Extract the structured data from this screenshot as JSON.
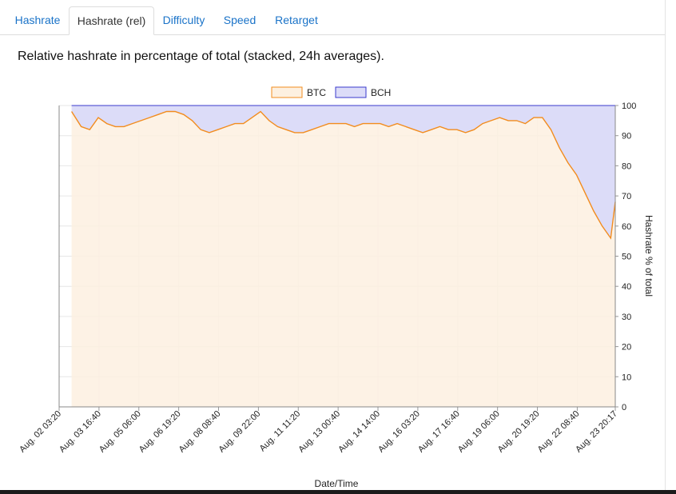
{
  "tabs": [
    {
      "label": "Hashrate"
    },
    {
      "label": "Hashrate (rel)"
    },
    {
      "label": "Difficulty"
    },
    {
      "label": "Speed"
    },
    {
      "label": "Retarget"
    }
  ],
  "active_tab": "Hashrate (rel)",
  "subtitle": "Relative hashrate in percentage of total (stacked, 24h averages).",
  "colors": {
    "btc_line": "#f28c1e",
    "btc_fill": "#fdf0e0",
    "bch_line": "#3a3acc",
    "bch_fill": "#dcdcf8",
    "link": "#1a73c8"
  },
  "chart_data": {
    "type": "area",
    "stacked": true,
    "xlabel": "Date/Time",
    "ylabel": "Hashrate % of total",
    "ylim": [
      0,
      100
    ],
    "y_ticks": [
      "0",
      "10",
      "20",
      "30",
      "40",
      "50",
      "60",
      "70",
      "80",
      "90",
      "100"
    ],
    "y_axis_side": "right",
    "grid": true,
    "legend_position": "top",
    "x_ticks": [
      "Aug. 02 03:20",
      "Aug. 03 16:40",
      "Aug. 05 06:00",
      "Aug. 06 19:20",
      "Aug. 08 08:40",
      "Aug. 09 22:00",
      "Aug. 11 11:20",
      "Aug. 13 00:40",
      "Aug. 14 14:00",
      "Aug. 16 03:20",
      "Aug. 17 16:40",
      "Aug. 19 06:00",
      "Aug. 20 19:20",
      "Aug. 22 08:40",
      "Aug. 23 20:17"
    ],
    "x_range": [
      "Aug. 02 03:20",
      "Aug. 23 20:17"
    ],
    "series": [
      {
        "name": "BTC",
        "x": [
          "Aug. 02 15:00",
          "Aug. 03 00:00",
          "Aug. 03 08:00",
          "Aug. 03 16:00",
          "Aug. 04 00:00",
          "Aug. 04 08:00",
          "Aug. 04 16:00",
          "Aug. 05 00:00",
          "Aug. 05 08:00",
          "Aug. 05 16:00",
          "Aug. 06 00:00",
          "Aug. 06 08:00",
          "Aug. 06 16:00",
          "Aug. 07 00:00",
          "Aug. 07 08:00",
          "Aug. 07 16:00",
          "Aug. 08 00:00",
          "Aug. 08 08:00",
          "Aug. 08 16:00",
          "Aug. 09 00:00",
          "Aug. 09 08:00",
          "Aug. 09 16:00",
          "Aug. 10 00:00",
          "Aug. 10 08:00",
          "Aug. 10 16:00",
          "Aug. 11 00:00",
          "Aug. 11 08:00",
          "Aug. 11 16:00",
          "Aug. 12 00:00",
          "Aug. 12 08:00",
          "Aug. 12 16:00",
          "Aug. 13 00:00",
          "Aug. 13 08:00",
          "Aug. 13 16:00",
          "Aug. 14 00:00",
          "Aug. 14 08:00",
          "Aug. 14 16:00",
          "Aug. 15 00:00",
          "Aug. 15 08:00",
          "Aug. 15 16:00",
          "Aug. 16 00:00",
          "Aug. 16 08:00",
          "Aug. 16 16:00",
          "Aug. 17 00:00",
          "Aug. 17 08:00",
          "Aug. 17 16:00",
          "Aug. 18 00:00",
          "Aug. 18 08:00",
          "Aug. 18 16:00",
          "Aug. 19 00:00",
          "Aug. 19 08:00",
          "Aug. 19 16:00",
          "Aug. 20 00:00",
          "Aug. 20 08:00",
          "Aug. 20 16:00",
          "Aug. 21 00:00",
          "Aug. 21 08:00",
          "Aug. 21 16:00",
          "Aug. 22 00:00",
          "Aug. 22 08:00",
          "Aug. 22 16:00",
          "Aug. 23 00:00",
          "Aug. 23 08:00",
          "Aug. 23 16:00",
          "Aug. 23 20:17"
        ],
        "values": [
          98,
          93,
          92,
          96,
          94,
          93,
          93,
          94,
          95,
          96,
          97,
          98,
          98,
          97,
          95,
          92,
          91,
          92,
          93,
          94,
          94,
          96,
          98,
          95,
          93,
          92,
          91,
          91,
          92,
          93,
          94,
          94,
          94,
          93,
          94,
          94,
          94,
          93,
          94,
          93,
          92,
          91,
          92,
          93,
          92,
          92,
          91,
          92,
          94,
          95,
          96,
          95,
          95,
          94,
          96,
          96,
          92,
          86,
          81,
          77,
          71,
          65,
          60,
          56,
          68
        ]
      },
      {
        "name": "BCH",
        "x": [
          "Aug. 02 15:00",
          "Aug. 23 20:17"
        ],
        "values": [
          100,
          100
        ]
      }
    ]
  }
}
